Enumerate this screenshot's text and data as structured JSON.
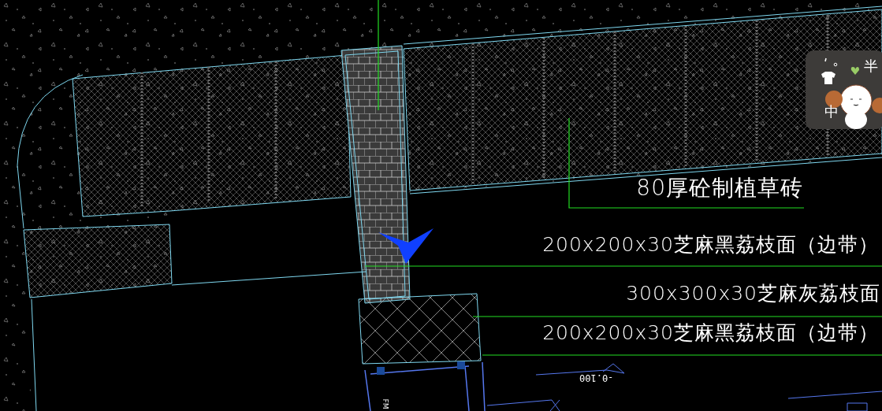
{
  "drawing": {
    "labels": [
      {
        "text": "80厚砼制植草砖"
      },
      {
        "text": "200x200x30芝麻黑荔枝面（边带）"
      },
      {
        "text": "300x300x30芝麻灰荔枝面"
      },
      {
        "text": "200x200x30芝麻黑荔枝面（边带）"
      }
    ],
    "elevation_mark": "-0.100",
    "door_tag": "FM"
  },
  "ime_toolbar": {
    "width_mode": "半",
    "input_mode": "中"
  }
}
